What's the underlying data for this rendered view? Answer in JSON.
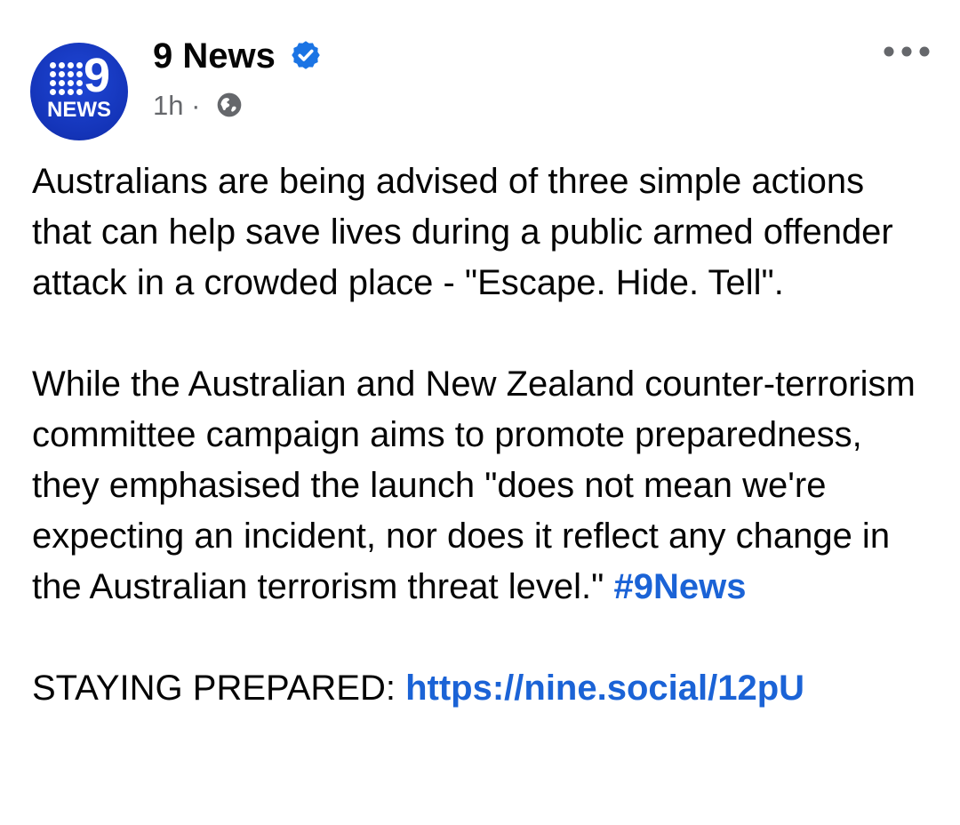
{
  "post": {
    "page_name": "9 News",
    "time": "1h",
    "separator": "·",
    "avatar": {
      "logo_word": "NEWS",
      "logo_number": "9",
      "brand_color": "#1434b8"
    },
    "verified_color": "#1b74e4",
    "privacy_icon": "globe-icon",
    "more_icon": "more-options-icon",
    "body": {
      "paragraph_1": "Australians are being advised of three simple actions that can help save lives during a public armed offender attack in a crowded place - \"Escape. Hide. Tell\".",
      "paragraph_2_text": "While the Australian and New Zealand counter-terrorism committee campaign aims to promote preparedness, they emphasised the launch \"does not mean we're expecting an incident, nor does it reflect any change in the Australian terrorism threat level.\" ",
      "hashtag": "#9News",
      "paragraph_3_text": "STAYING PREPARED: ",
      "link": "https://nine.social/12pU"
    },
    "link_color": "#1b63d6"
  }
}
